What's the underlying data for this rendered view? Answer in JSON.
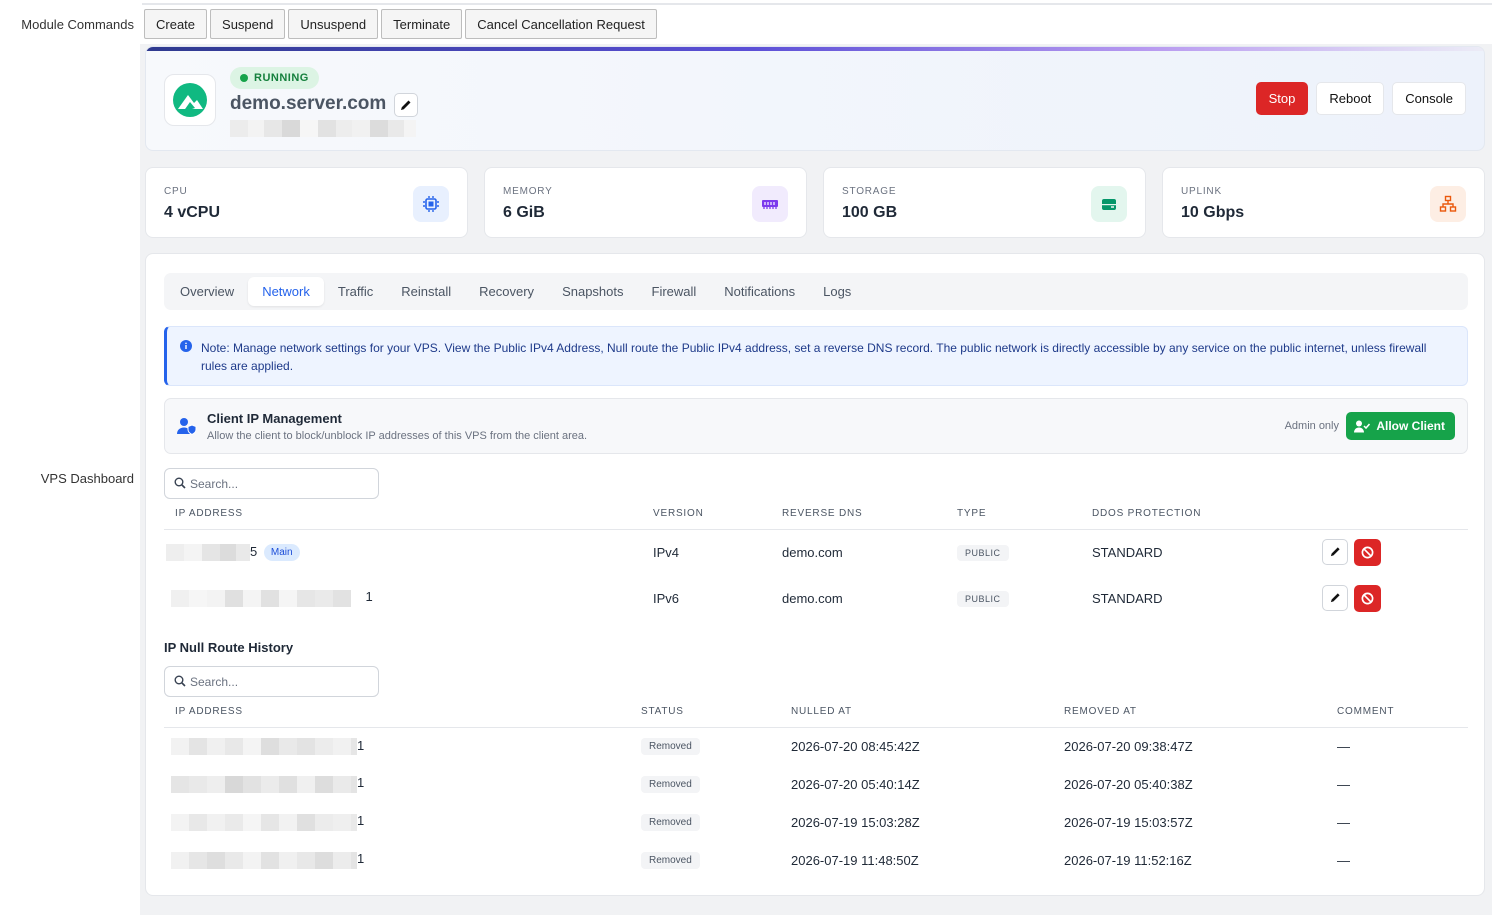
{
  "labels": {
    "module_commands": "Module Commands",
    "vps_dashboard": "VPS Dashboard"
  },
  "module_commands": [
    "Create",
    "Suspend",
    "Unsuspend",
    "Terminate",
    "Cancel Cancellation Request"
  ],
  "header": {
    "status": "RUNNING",
    "hostname": "demo.server.com",
    "actions": {
      "stop": "Stop",
      "reboot": "Reboot",
      "console": "Console"
    }
  },
  "stats": [
    {
      "caption": "CPU",
      "value": "4 vCPU",
      "icon": "cpu-icon",
      "color": "#2563eb",
      "bg": "#e8f0fe"
    },
    {
      "caption": "MEMORY",
      "value": "6 GiB",
      "icon": "memory-icon",
      "color": "#7c3aed",
      "bg": "#f1ebfd"
    },
    {
      "caption": "STORAGE",
      "value": "100 GB",
      "icon": "storage-icon",
      "color": "#059669",
      "bg": "#e3f6ee"
    },
    {
      "caption": "UPLINK",
      "value": "10 Gbps",
      "icon": "network-icon",
      "color": "#ea580c",
      "bg": "#fdeee4"
    }
  ],
  "tabs": [
    "Overview",
    "Network",
    "Traffic",
    "Reinstall",
    "Recovery",
    "Snapshots",
    "Firewall",
    "Notifications",
    "Logs"
  ],
  "active_tab": "Network",
  "note": "Note: Manage network settings for your VPS. View the Public IPv4 Address, Null route the Public IPv4 address, set a reverse DNS record. The public network is directly accessible by any service on the public internet, unless firewall rules are applied.",
  "client_ip": {
    "title": "Client IP Management",
    "description": "Allow the client to block/unblock IP addresses of this VPS from the client area.",
    "admin_only": "Admin only",
    "button": "Allow Client"
  },
  "search_placeholder": "Search...",
  "ip_table": {
    "headers": [
      "IP ADDRESS",
      "VERSION",
      "REVERSE DNS",
      "TYPE",
      "DDOS PROTECTION"
    ],
    "rows": [
      {
        "ip_suffix": "5",
        "main_badge": "Main",
        "version": "IPv4",
        "rdns": "demo.com",
        "type": "PUBLIC",
        "ddos": "STANDARD"
      },
      {
        "ip_suffix": "1",
        "main_badge": "",
        "version": "IPv6",
        "rdns": "demo.com",
        "type": "PUBLIC",
        "ddos": "STANDARD"
      }
    ]
  },
  "null_route": {
    "title": "IP Null Route History",
    "headers": [
      "IP ADDRESS",
      "STATUS",
      "NULLED AT",
      "REMOVED AT",
      "COMMENT"
    ],
    "rows": [
      {
        "ip_suffix": "1",
        "status": "Removed",
        "nulled": "2026-07-20 08:45:42Z",
        "removed": "2026-07-20 09:38:47Z",
        "comment": "—"
      },
      {
        "ip_suffix": "1",
        "status": "Removed",
        "nulled": "2026-07-20 05:40:14Z",
        "removed": "2026-07-20 05:40:38Z",
        "comment": "—"
      },
      {
        "ip_suffix": "1",
        "status": "Removed",
        "nulled": "2026-07-19 15:03:28Z",
        "removed": "2026-07-19 15:03:57Z",
        "comment": "—"
      },
      {
        "ip_suffix": "1",
        "status": "Removed",
        "nulled": "2026-07-19 11:48:50Z",
        "removed": "2026-07-19 11:52:16Z",
        "comment": "—"
      }
    ]
  }
}
